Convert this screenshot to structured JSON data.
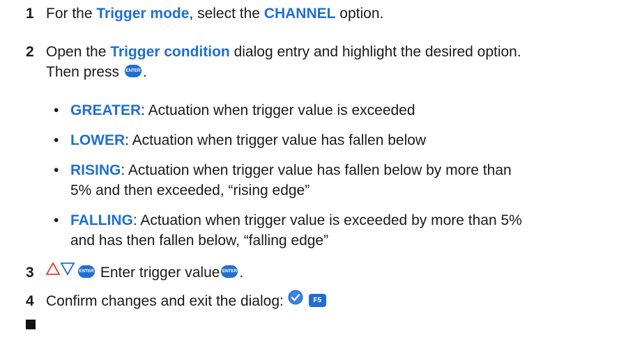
{
  "steps": [
    {
      "number": "1",
      "pre": "For the ",
      "hl1": "Trigger mode",
      "mid": ", select the ",
      "hl2": "CHANNEL",
      "post": " option."
    },
    {
      "number": "2",
      "pre": "Open the ",
      "hl1": "Trigger condition",
      "post_line1": " dialog entry and highlight the desired option.",
      "line2": "Then press ",
      "line2_end": ".",
      "key_label": "ENTER"
    },
    {
      "number": "3",
      "text": " Enter trigger value",
      "end": ".",
      "key_label": "ENTER"
    },
    {
      "number": "4",
      "text": "Confirm changes and exit the dialog: ",
      "key_label": "F5"
    }
  ],
  "options": [
    {
      "term": "GREATER",
      "desc_line1": ": Actuation when trigger value is exceeded",
      "desc_line2": ""
    },
    {
      "term": "LOWER",
      "desc_line1": ": Actuation when trigger value has fallen below",
      "desc_line2": ""
    },
    {
      "term": "RISING",
      "desc_line1": ": Actuation when trigger value has fallen below by more than",
      "desc_line2": "5% and then exceeded, “rising edge”"
    },
    {
      "term": "FALLING",
      "desc_line1": ": Actuation when trigger value is exceeded by more than 5%",
      "desc_line2": "and has then fallen below, “falling edge”"
    }
  ],
  "bullet_char": "•",
  "icons": {
    "enter_key": "enter-key-icon",
    "f5_key": "f5-key-icon",
    "up_down_arrows": "up-down-arrows-icon",
    "confirm_check": "check-circle-icon",
    "end_marker": "end-of-section-square"
  },
  "colors": {
    "highlight": "#1f6fd1",
    "text": "#1a1a1a",
    "arrow_up": "#e53935",
    "arrow_down": "#1f6fd1",
    "check_circle": "#3b82e6"
  }
}
